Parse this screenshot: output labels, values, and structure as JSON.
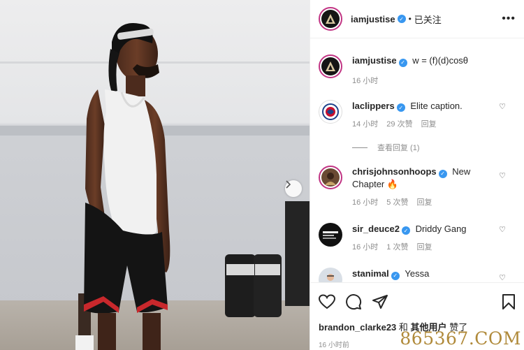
{
  "post": {
    "author": "iamjustise",
    "follow_state": "已关注",
    "caption": "w = (f)(d)cosθ",
    "caption_time": "16 小时",
    "next_icon": "chevron-right-icon"
  },
  "comments": [
    {
      "user": "laclippers",
      "verified": true,
      "text": "Elite caption.",
      "time": "14 小时",
      "likes": "29 次赞",
      "reply": "回复",
      "view_replies": "查看回复 (1)"
    },
    {
      "user": "chrisjohnsonhoops",
      "verified": true,
      "text": "New Chapter 🔥",
      "time": "16 小时",
      "likes": "5 次赞",
      "reply": "回复"
    },
    {
      "user": "sir_deuce2",
      "verified": true,
      "text": "Driddy Gang",
      "time": "16 小时",
      "likes": "1 次赞",
      "reply": "回复"
    },
    {
      "user": "stanimal",
      "verified": true,
      "text": "Yessa"
    }
  ],
  "footer": {
    "liked_user": "brandon_clarke23",
    "liked_and": "和",
    "liked_others": "其他用户",
    "liked_suffix": "赞了",
    "time": "16 小时前"
  },
  "watermark": "865367.COM",
  "colors": {
    "verified": "#3897f0",
    "ring": "#c13584",
    "meta": "#8e8e8e"
  }
}
